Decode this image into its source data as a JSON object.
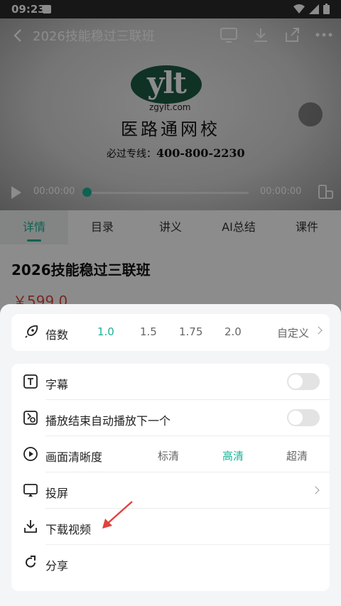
{
  "status": {
    "time": "09:23"
  },
  "video": {
    "title": "2026技能稳过三联班",
    "logo_text": "ylt",
    "logo_url": "zgylt.com",
    "logo_name": "医路通网校",
    "hotline_label": "必过专线：",
    "hotline_number": "400-800-2230",
    "current_time": "00:00:00",
    "total_time": "00:00:00",
    "progress": 0
  },
  "tabs": [
    {
      "label": "详情",
      "active": true
    },
    {
      "label": "目录"
    },
    {
      "label": "讲义"
    },
    {
      "label": "AI总结"
    },
    {
      "label": "课件"
    }
  ],
  "course": {
    "title": "2026技能稳过三联班",
    "price": "￥599.0"
  },
  "sheet": {
    "speed": {
      "label": "倍数",
      "options": [
        "1.0",
        "1.5",
        "1.75",
        "2.0"
      ],
      "selected": "1.0",
      "custom": "自定义"
    },
    "subtitle": {
      "label": "字幕",
      "on": false
    },
    "autoplay": {
      "label": "播放结束自动播放下一个",
      "on": false
    },
    "quality": {
      "label": "画面清晰度",
      "options": [
        "标清",
        "高清",
        "超清"
      ],
      "selected": "高清"
    },
    "cast": {
      "label": "投屏"
    },
    "download": {
      "label": "下载视频"
    },
    "share": {
      "label": "分享"
    }
  },
  "colors": {
    "accent": "#1ab394",
    "price": "#e24a3c",
    "annotation": "#e0433a"
  }
}
